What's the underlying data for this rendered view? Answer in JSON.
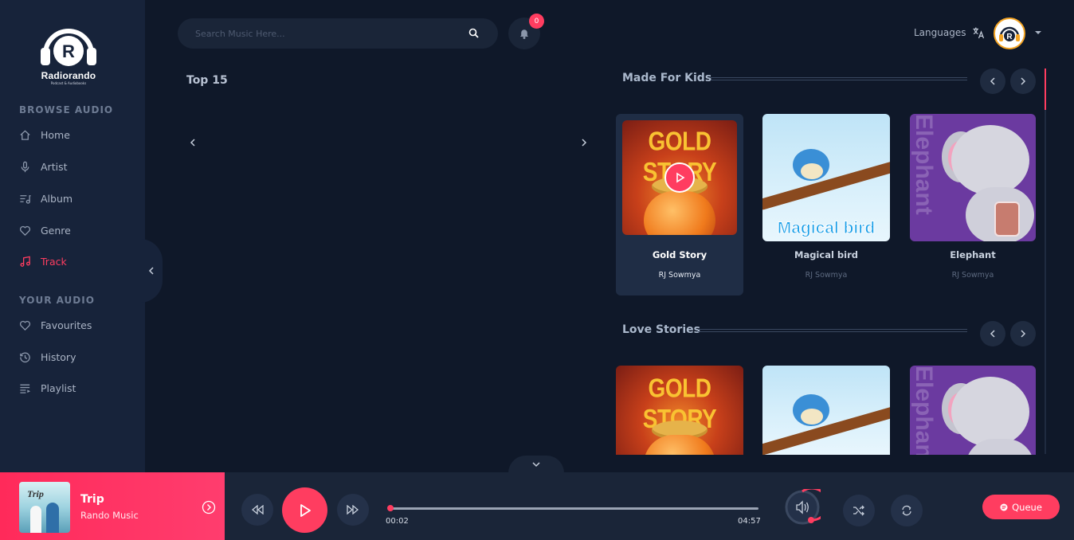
{
  "brand": {
    "name": "Radiorando",
    "tagline": "Podcast & Audiobooks"
  },
  "sidebar": {
    "browse_heading": "BROWSE AUDIO",
    "browse_items": [
      {
        "label": "Home",
        "icon": "home-icon"
      },
      {
        "label": "Artist",
        "icon": "microphone-icon"
      },
      {
        "label": "Album",
        "icon": "album-list-icon"
      },
      {
        "label": "Genre",
        "icon": "genre-icon"
      },
      {
        "label": "Track",
        "icon": "music-note-icon",
        "active": true
      }
    ],
    "your_heading": "YOUR AUDIO",
    "your_items": [
      {
        "label": "Favourites",
        "icon": "heart-icon"
      },
      {
        "label": "History",
        "icon": "history-icon"
      },
      {
        "label": "Playlist",
        "icon": "playlist-icon"
      }
    ]
  },
  "header": {
    "search_placeholder": "Search Music Here...",
    "notification_count": "0",
    "languages_label": "Languages"
  },
  "top15": {
    "title": "Top 15"
  },
  "sections": [
    {
      "title": "Made For Kids",
      "cards": [
        {
          "title": "Gold Story",
          "artist": "RJ Sowmya",
          "art_text": "GOLD STORY",
          "selected": true
        },
        {
          "title": "Magical bird",
          "artist": "RJ Sowmya",
          "art_text": "Magical bird"
        },
        {
          "title": "Elephant",
          "artist": "RJ Sowmya",
          "art_text": "Elephant"
        }
      ]
    },
    {
      "title": "Love Stories",
      "cards": [
        {
          "art_text": "GOLD STORY"
        },
        {
          "art_text": ""
        },
        {
          "art_text": "Elephant"
        }
      ]
    }
  ],
  "player": {
    "track_title": "Trip",
    "track_artist": "Rando Music",
    "cover_text": "Trip",
    "current_time": "00:02",
    "total_time": "04:57",
    "progress_fraction": 0.007,
    "queue_label": "Queue"
  },
  "colors": {
    "accent": "#ff3d60",
    "background": "#0f1829",
    "sidebar": "#17233a"
  }
}
